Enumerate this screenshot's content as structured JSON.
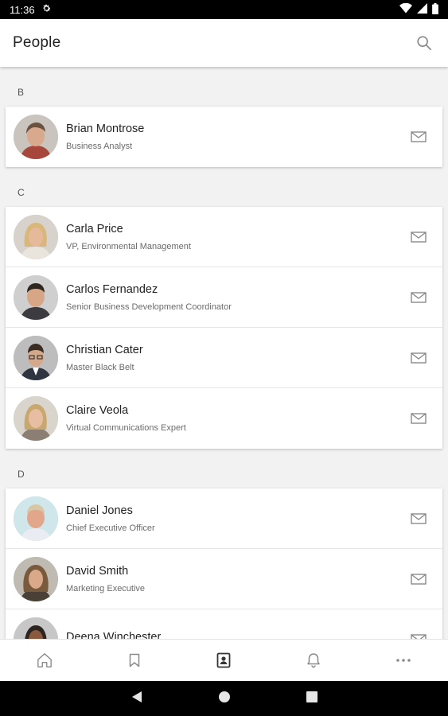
{
  "status_bar": {
    "time": "11:36",
    "settings_icon": "gear-icon",
    "wifi_icon": "wifi-icon",
    "signal_icon": "signal-icon",
    "battery_icon": "battery-icon"
  },
  "header": {
    "title": "People",
    "search_icon": "search-icon"
  },
  "sections": [
    {
      "letter": "B",
      "people": [
        {
          "name": "Brian Montrose",
          "role": "Business Analyst"
        }
      ]
    },
    {
      "letter": "C",
      "people": [
        {
          "name": "Carla Price",
          "role": "VP, Environmental Management"
        },
        {
          "name": "Carlos Fernandez",
          "role": "Senior Business Development Coordinator"
        },
        {
          "name": "Christian Cater",
          "role": "Master Black Belt"
        },
        {
          "name": "Claire Veola",
          "role": "Virtual Communications Expert"
        }
      ]
    },
    {
      "letter": "D",
      "people": [
        {
          "name": "Daniel Jones",
          "role": "Chief Executive Officer"
        },
        {
          "name": "David Smith",
          "role": "Marketing Executive"
        },
        {
          "name": "Deena Winchester",
          "role": ""
        }
      ]
    }
  ],
  "tab_bar": {
    "items": [
      "home-icon",
      "bookmark-icon",
      "contacts-icon",
      "bell-icon",
      "more-icon"
    ],
    "active": "contacts-icon"
  },
  "nav_bar": {
    "items": [
      "back-icon",
      "home-circle-icon",
      "recents-icon"
    ]
  },
  "colors": {
    "background": "#f2f2f2",
    "card": "#ffffff",
    "icon_gray": "#8a8a8a",
    "text": "#222222"
  }
}
